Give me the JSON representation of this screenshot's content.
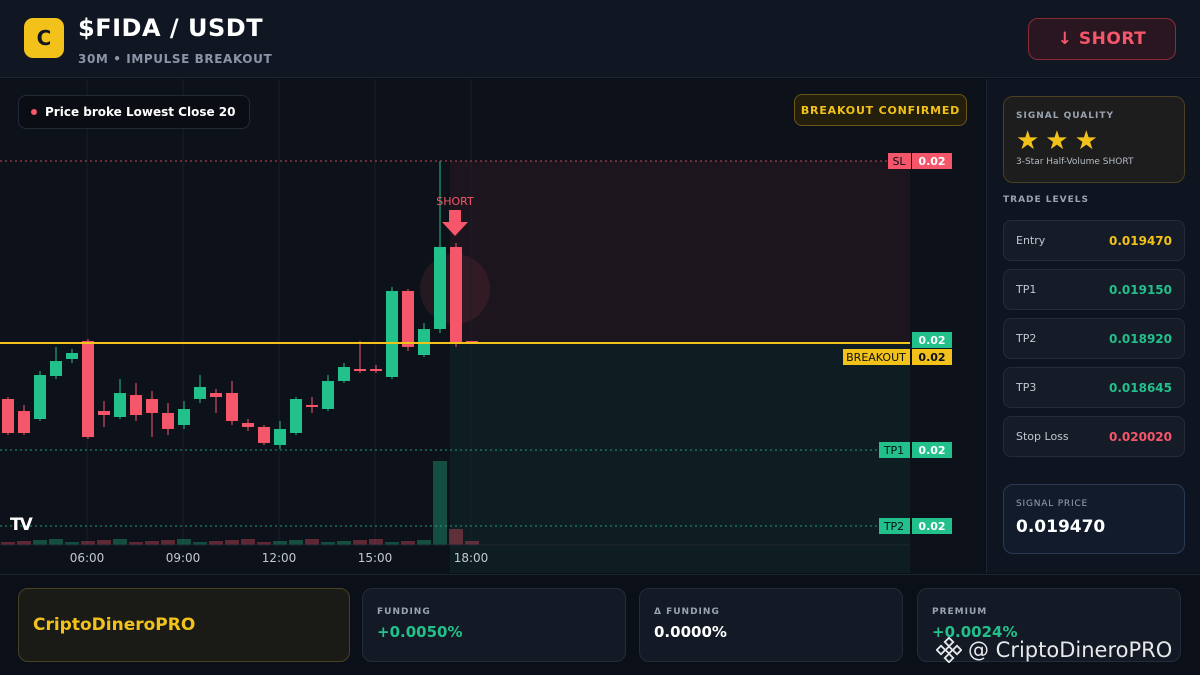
{
  "header": {
    "logo_letter": "C",
    "title": "$FIDA / USDT",
    "subtitle": "30M • IMPULSE BREAKOUT",
    "action_label": "↓ SHORT"
  },
  "chart": {
    "signal_text": "Price broke Lowest Close 20",
    "confirm_text": "BREAKOUT CONFIRMED",
    "short_marker": "SHORT",
    "tv_logo": "TV",
    "time_labels": [
      "06:00",
      "09:00",
      "12:00",
      "15:00",
      "18:00"
    ],
    "levels": [
      {
        "name": "SL",
        "value": "0.02",
        "color": "#f5566a"
      },
      {
        "name": "",
        "value": "0.02",
        "color": "#22c08a"
      },
      {
        "name": "BREAKOUT",
        "value": "0.02",
        "color": "#f2c21b"
      },
      {
        "name": "TP1",
        "value": "0.02",
        "color": "#22c08a"
      },
      {
        "name": "TP2",
        "value": "0.02",
        "color": "#22c08a"
      }
    ],
    "colors": {
      "up": "#22c08a",
      "down": "#f5566a",
      "breakout": "#f2c21b"
    }
  },
  "sidebar": {
    "quality_label": "SIGNAL QUALITY",
    "stars": "★★★",
    "star_count": 3,
    "quality_desc": "3-Star Half-Volume SHORT",
    "levels_title": "TRADE LEVELS",
    "levels": [
      {
        "label": "Entry",
        "value": "0.019470",
        "color": "#f2c21b"
      },
      {
        "label": "TP1",
        "value": "0.019150",
        "color": "#22c08a"
      },
      {
        "label": "TP2",
        "value": "0.018920",
        "color": "#22c08a"
      },
      {
        "label": "TP3",
        "value": "0.018645",
        "color": "#22c08a"
      },
      {
        "label": "Stop Loss",
        "value": "0.020020",
        "color": "#f5566a"
      }
    ],
    "price_label": "SIGNAL PRICE",
    "price_value": "0.019470"
  },
  "footer": {
    "brand": "CriptoDineroPRO",
    "metrics": [
      {
        "label": "FUNDING",
        "value": "+0.0050%",
        "color": "#22c08a"
      },
      {
        "label": "Δ FUNDING",
        "value": "0.0000%",
        "color": "#ffffff"
      },
      {
        "label": "PREMIUM",
        "value": "+0.0024%",
        "color": "#22c08a"
      }
    ],
    "watermark": "@ CriptoDineroPRO"
  }
}
